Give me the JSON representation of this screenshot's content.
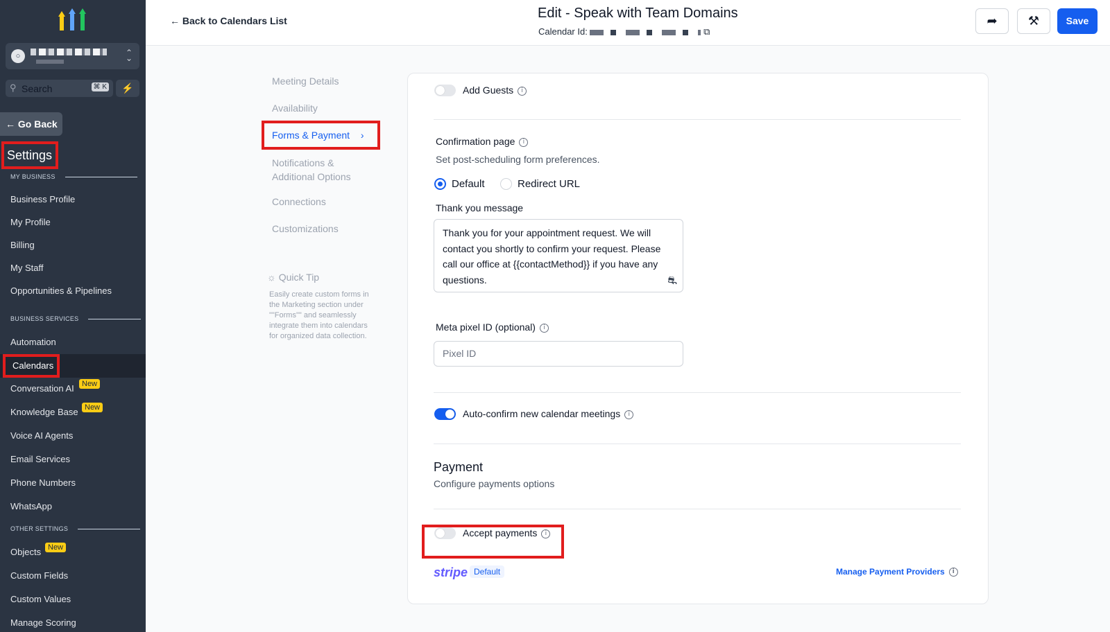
{
  "sidebar": {
    "search_label": "Search",
    "search_shortcut": "⌘ K",
    "go_back": "Go Back",
    "settings_title": "Settings",
    "sections": {
      "my_business": "MY BUSINESS",
      "business_services": "BUSINESS SERVICES",
      "other_settings": "OTHER SETTINGS"
    },
    "items": {
      "business_profile": "Business Profile",
      "my_profile": "My Profile",
      "billing": "Billing",
      "my_staff": "My Staff",
      "opportunities": "Opportunities & Pipelines",
      "automation": "Automation",
      "calendars": "Calendars",
      "conversation_ai": "Conversation AI",
      "knowledge_base": "Knowledge Base",
      "voice_ai": "Voice AI Agents",
      "email_services": "Email Services",
      "phone_numbers": "Phone Numbers",
      "whatsapp": "WhatsApp",
      "objects": "Objects",
      "custom_fields": "Custom Fields",
      "custom_values": "Custom Values",
      "manage_scoring": "Manage Scoring"
    },
    "new_badge": "New"
  },
  "header": {
    "back_link": "Back to Calendars List",
    "title": "Edit - Speak with Team Domains",
    "calendar_id_label": "Calendar Id:",
    "save": "Save"
  },
  "inner_nav": {
    "meeting_details": "Meeting Details",
    "availability": "Availability",
    "forms_payment": "Forms & Payment",
    "notifications_1": "Notifications &",
    "notifications_2": "Additional Options",
    "connections": "Connections",
    "customizations": "Customizations",
    "quick_tip_title": "Quick Tip",
    "quick_tip_body": "Easily create custom forms in the Marketing section under \"\"Forms\"\" and seamlessly integrate them into calendars for organized data collection."
  },
  "form": {
    "add_guests": "Add Guests",
    "confirmation_page": "Confirmation page",
    "confirmation_desc": "Set post-scheduling form preferences.",
    "radio_default": "Default",
    "radio_redirect": "Redirect URL",
    "thank_you_label": "Thank you message",
    "thank_you_message": "Thank you for your appointment request. We will contact you shortly to confirm your request. Please call our office at {{contactMethod}} if you have any questions.",
    "meta_pixel_label": "Meta pixel ID (optional)",
    "meta_pixel_placeholder": "Pixel ID",
    "auto_confirm": "Auto-confirm new calendar meetings",
    "payment_title": "Payment",
    "payment_desc": "Configure payments options",
    "accept_payments": "Accept payments",
    "stripe": "stripe",
    "stripe_badge": "Default",
    "manage_providers": "Manage Payment Providers"
  }
}
